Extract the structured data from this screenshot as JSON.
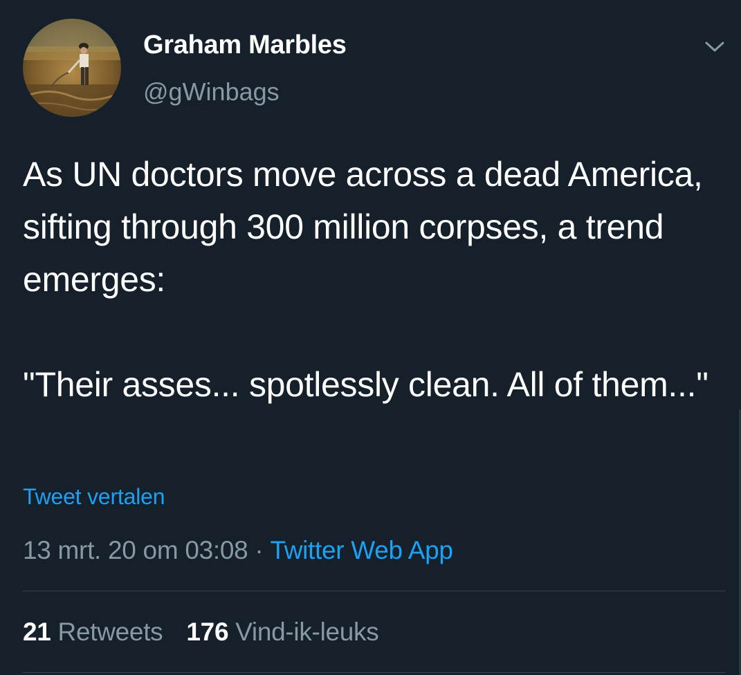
{
  "author": {
    "display_name": "Graham Marbles",
    "handle": "@gWinbags",
    "avatar_icon": "painting-farmer-in-field-avatar"
  },
  "tweet": {
    "paragraph_1": "As UN doctors move across a dead America, sifting through 300 million corpses, a trend emerges:",
    "paragraph_2": "\"Their asses... spotlessly clean. All of them...\""
  },
  "translate_link": "Tweet vertalen",
  "meta": {
    "timestamp": "13 mrt. 20 om 03:08",
    "separator": "·",
    "source": "Twitter Web App"
  },
  "stats": {
    "retweets_count": "21",
    "retweets_label": "Retweets",
    "likes_count": "176",
    "likes_label": "Vind-ik-leuks"
  },
  "icons": {
    "menu": "chevron-down-icon"
  },
  "colors": {
    "background": "#15202b",
    "accent": "#1da1f2",
    "secondary_text": "#8899a6"
  }
}
